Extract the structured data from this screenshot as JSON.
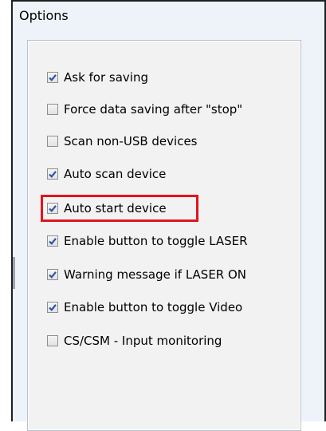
{
  "window": {
    "title": "Options"
  },
  "options": [
    {
      "label": "Ask for saving",
      "checked": true
    },
    {
      "label": "Force data saving after \"stop\"",
      "checked": false
    },
    {
      "label": "Scan non-USB devices",
      "checked": false
    },
    {
      "label": "Auto scan device",
      "checked": true
    },
    {
      "label": "Auto start device",
      "checked": true
    },
    {
      "label": "Enable button to toggle LASER",
      "checked": true
    },
    {
      "label": "Warning message if LASER ON",
      "checked": true
    },
    {
      "label": "Enable button to toggle Video",
      "checked": true
    },
    {
      "label": "CS/CSM - Input monitoring",
      "checked": false
    }
  ],
  "highlighted_option": "Auto start device",
  "colors": {
    "highlight": "#e3141b",
    "check": "#2b55a6"
  }
}
